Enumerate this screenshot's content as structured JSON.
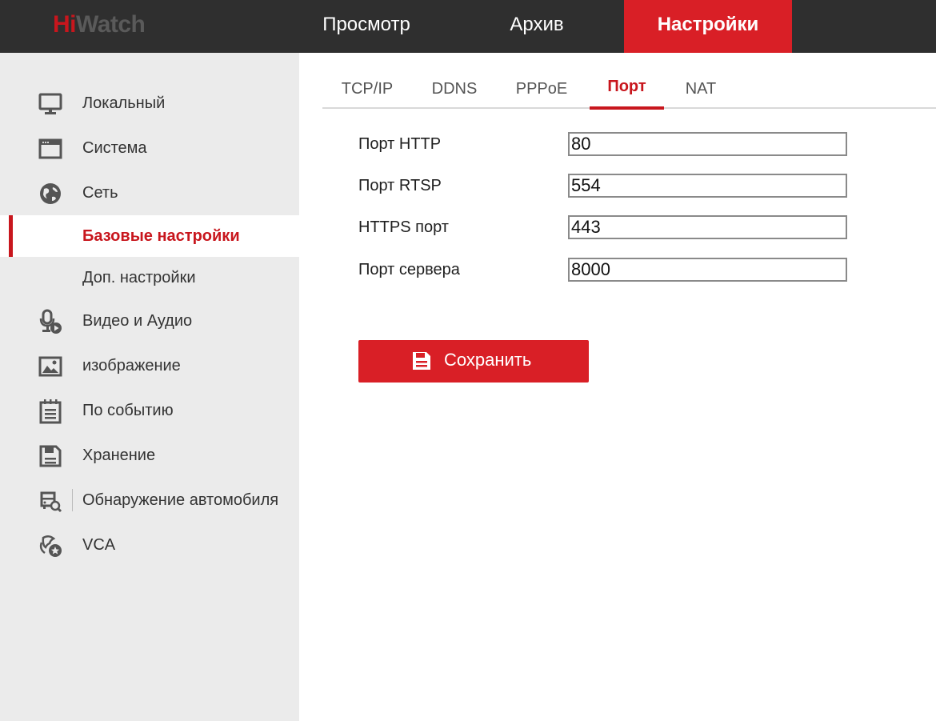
{
  "header": {
    "logo": {
      "part1": "Hi",
      "part2": "Watch"
    },
    "nav": [
      {
        "label": "Просмотр"
      },
      {
        "label": "Архив"
      },
      {
        "label": "Настройки",
        "active": true
      }
    ]
  },
  "sidebar": {
    "items": [
      {
        "label": "Локальный",
        "icon": "monitor-icon"
      },
      {
        "label": "Система",
        "icon": "window-icon"
      },
      {
        "label": "Сеть",
        "icon": "globe-icon"
      },
      {
        "label": "Базовые настройки",
        "active": true
      },
      {
        "label": "Доп. настройки"
      },
      {
        "label": "Видео и Аудио",
        "icon": "microphone-play-icon"
      },
      {
        "label": "изображение",
        "icon": "image-icon"
      },
      {
        "label": "По событию",
        "icon": "calendar-list-icon"
      },
      {
        "label": "Хранение",
        "icon": "floppy-disk-icon"
      },
      {
        "label": "Обнаружение автомобиля",
        "icon": "vehicle-search-icon"
      },
      {
        "label": "VCA",
        "icon": "vca-star-icon"
      }
    ]
  },
  "tabs": [
    {
      "label": "TCP/IP"
    },
    {
      "label": "DDNS"
    },
    {
      "label": "PPPoE"
    },
    {
      "label": "Порт",
      "active": true
    },
    {
      "label": "NAT"
    }
  ],
  "form": {
    "fields": [
      {
        "label": "Порт HTTP",
        "value": "80"
      },
      {
        "label": "Порт RTSP",
        "value": "554"
      },
      {
        "label": "HTTPS порт",
        "value": "443"
      },
      {
        "label": "Порт сервера",
        "value": "8000"
      }
    ],
    "save_label": "Сохранить",
    "save_icon": "floppy-disk-icon"
  },
  "colors": {
    "accent": "#d91f26",
    "header_bg": "#2f2f2f",
    "sidebar_bg": "#ebebeb"
  }
}
